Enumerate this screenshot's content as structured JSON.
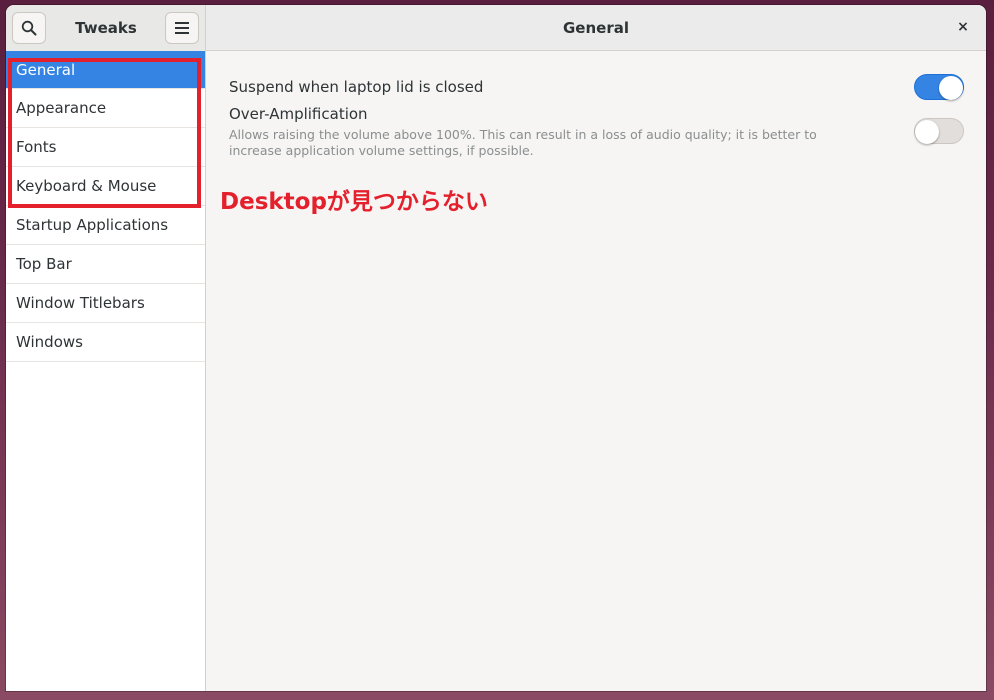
{
  "app": {
    "name": "Tweaks",
    "page_title": "General",
    "close_glyph": "×"
  },
  "sidebar": {
    "items": [
      {
        "label": "General",
        "selected": true
      },
      {
        "label": "Appearance"
      },
      {
        "label": "Fonts"
      },
      {
        "label": "Keyboard & Mouse"
      },
      {
        "label": "Startup Applications"
      },
      {
        "label": "Top Bar"
      },
      {
        "label": "Window Titlebars"
      },
      {
        "label": "Windows"
      }
    ]
  },
  "settings": {
    "lid_suspend": {
      "title": "Suspend when laptop lid is closed",
      "enabled": true
    },
    "over_amplification": {
      "title": "Over-Amplification",
      "description": "Allows raising the volume above 100%. This can result in a loss of audio quality; it is better to increase application volume settings, if possible.",
      "enabled": false
    }
  },
  "annotation": {
    "text": "Desktopが見つからない",
    "color": "#e3202b"
  },
  "colors": {
    "accent": "#3584e4",
    "annotation": "#e3202b"
  }
}
